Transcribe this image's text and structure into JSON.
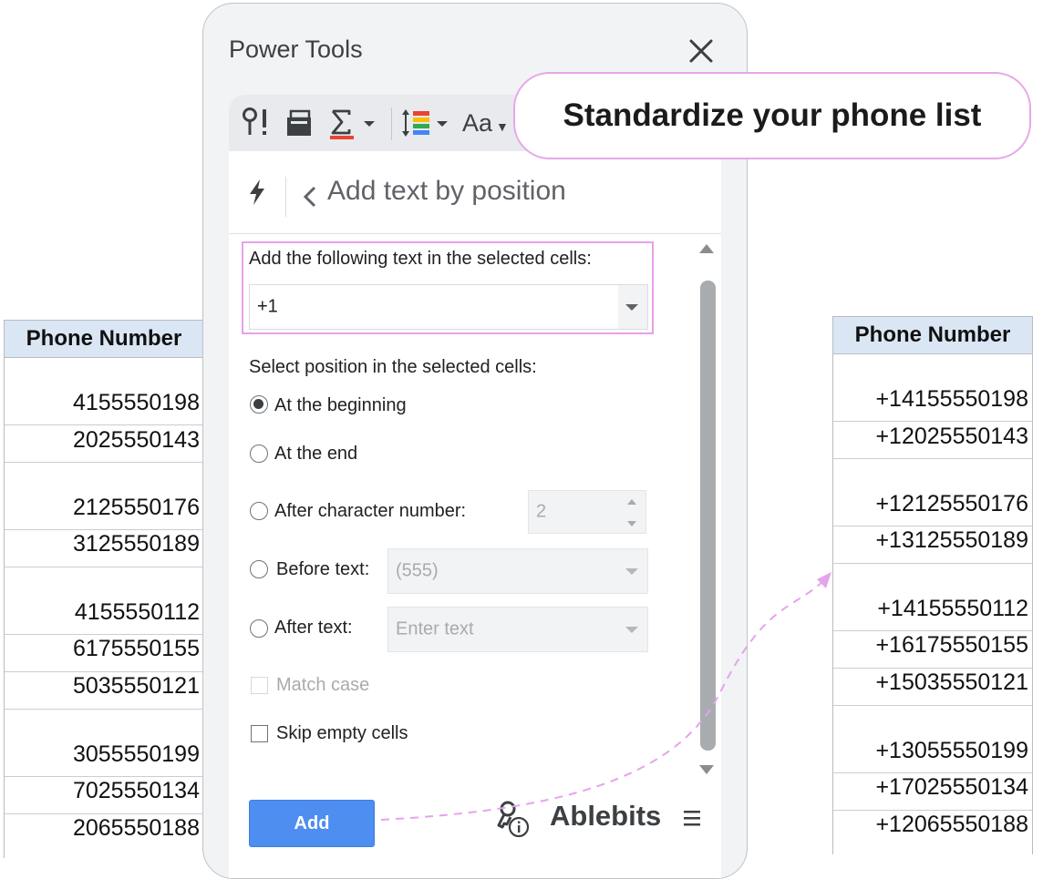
{
  "left_table": {
    "header": "Phone Number",
    "rows": [
      "4155550198",
      "2025550143",
      "2125550176",
      "3125550189",
      "4155550112",
      "6175550155",
      "5035550121",
      "3055550199",
      "7025550134",
      "2065550188"
    ]
  },
  "right_table": {
    "header": "Phone Number",
    "rows": [
      "+14155550198",
      "+12025550143",
      "+12125550176",
      "+13125550189",
      "+14155550112",
      "+16175550155",
      "+15035550121",
      "+13055550199",
      "+17025550134",
      "+12065550188"
    ]
  },
  "panel": {
    "title": "Power Tools",
    "toolbar": {
      "icons": [
        "search-replace-icon",
        "merge-icon",
        "formula-sum-icon",
        "text-height-icon",
        "text-format-icon"
      ],
      "text_format_glyph": "Aa"
    },
    "header": {
      "back_title": "Add text by position"
    },
    "text_label": "Add the following text in the selected cells:",
    "text_value": "+1",
    "position_label": "Select position in the selected cells:",
    "options": {
      "beginning": "At the beginning",
      "end": "At the end",
      "after_char": "After character number:",
      "before_text": "Before text:",
      "after_text": "After text:"
    },
    "selected_option": "beginning",
    "after_char_value": "2",
    "before_text_value": "(555)",
    "after_text_placeholder": "Enter text",
    "match_case_label": "Match case",
    "skip_empty_label": "Skip empty cells",
    "add_button": "Add",
    "brand": "Ablebits"
  },
  "callout": {
    "text": "Standardize your phone list"
  },
  "colors": {
    "accent_button": "#4d8ef0",
    "highlight_border": "#e8a1ea",
    "table_header_bg": "#dbe6f4"
  }
}
